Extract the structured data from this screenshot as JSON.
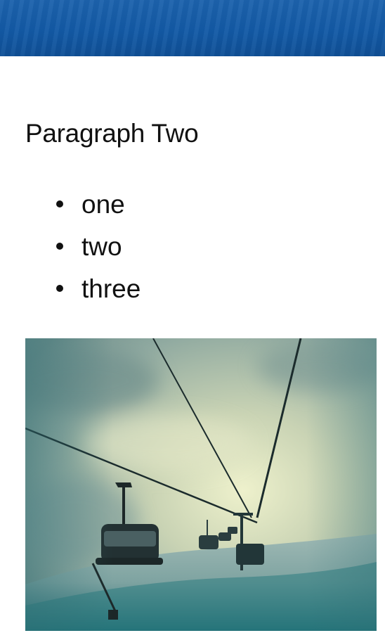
{
  "header": {
    "color": "#135aa6"
  },
  "content": {
    "paragraph": "Paragraph Two",
    "list_items": [
      {
        "label": "one"
      },
      {
        "label": "two"
      },
      {
        "label": "three"
      }
    ]
  },
  "image": {
    "subject": "ski chairlift in fog over snowy slope",
    "alt": "Ski chairlift"
  }
}
